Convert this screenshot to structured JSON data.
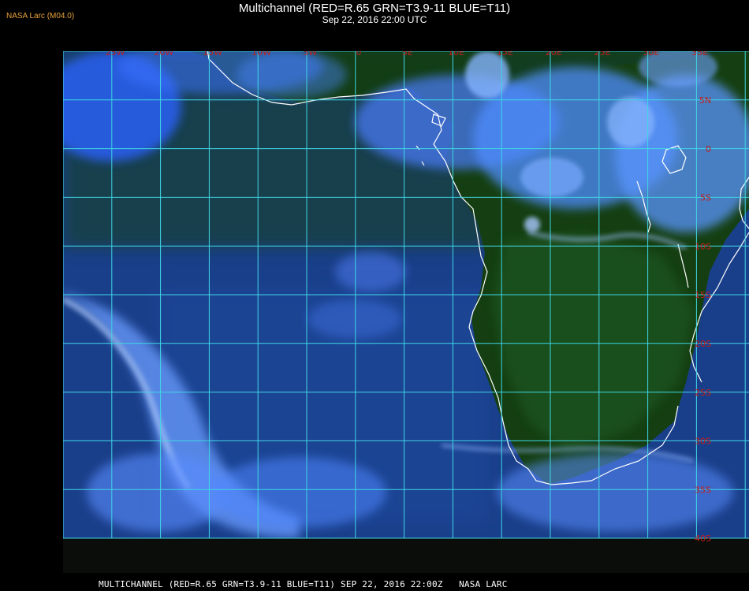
{
  "header": {
    "corner_label": "NASA Larc (M04.0)",
    "title": "Multichannel (RED=R.65 GRN=T3.9-11 BLUE=T11)",
    "subtitle": "Sep 22, 2016 22:00 UTC"
  },
  "footer": {
    "caption": "MULTICHANNEL (RED=R.65 GRN=T3.9-11 BLUE=T11) SEP 22, 2016 22:00Z   NASA LARC"
  },
  "map": {
    "longitude_labels": [
      "25W",
      "20W",
      "15W",
      "10W",
      "5W",
      "0",
      "5E",
      "10E",
      "15E",
      "20E",
      "25E",
      "30E",
      "35E"
    ],
    "latitude_labels": [
      "5N",
      "0",
      "5S",
      "10S",
      "15S",
      "20S",
      "25S",
      "30S",
      "35S",
      "40S"
    ],
    "colors": {
      "grid": "#3fd7e6",
      "label": "#c41e1e",
      "coast": "#ffffff",
      "land": "#123d0c",
      "ocean": "#1a3f8a",
      "cloud": "#4a86ff"
    }
  }
}
